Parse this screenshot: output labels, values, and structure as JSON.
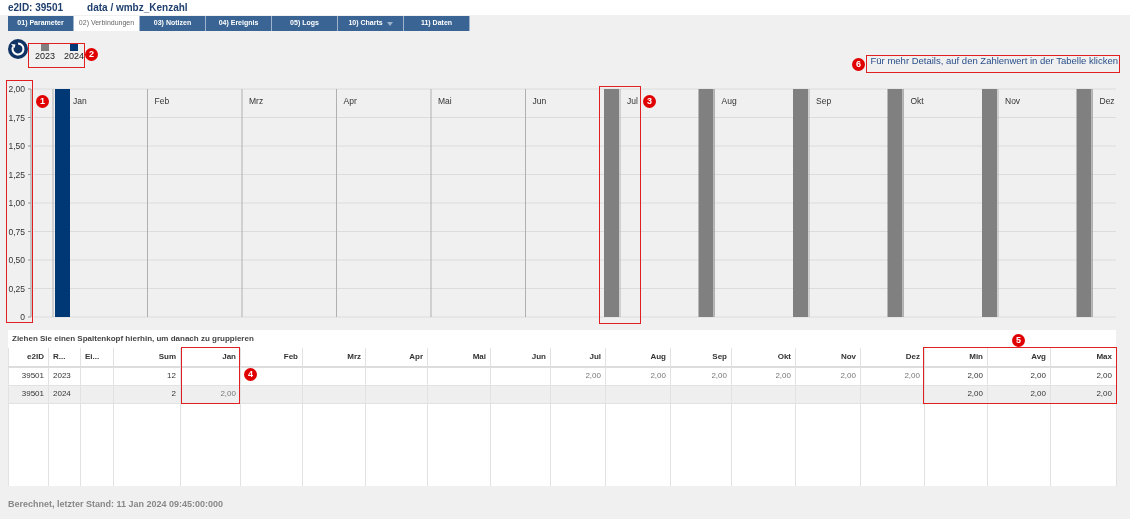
{
  "header": {
    "id_label": "e2ID: 39501",
    "path": "data / wmbz_Kenzahl"
  },
  "tabs": [
    {
      "label": "01) Parameter",
      "selected": false,
      "dropdown": false
    },
    {
      "label": "02) Verbindungen",
      "selected": true,
      "dropdown": false
    },
    {
      "label": "03) Notizen",
      "selected": false,
      "dropdown": false
    },
    {
      "label": "04) Ereignis",
      "selected": false,
      "dropdown": false
    },
    {
      "label": "05) Logs",
      "selected": false,
      "dropdown": false
    },
    {
      "label": "10) Charts",
      "selected": false,
      "dropdown": true
    },
    {
      "label": "11) Daten",
      "selected": false,
      "dropdown": false
    }
  ],
  "details_hint": "Für mehr Details, auf den Zahlenwert in der Tabelle  klicken",
  "chart_data": {
    "type": "bar",
    "categories": [
      "Jan",
      "Feb",
      "Mrz",
      "Apr",
      "Mai",
      "Jun",
      "Jul",
      "Aug",
      "Sep",
      "Okt",
      "Nov",
      "Dez"
    ],
    "series": [
      {
        "name": "2023",
        "color": "#808080",
        "values": [
          null,
          null,
          null,
          null,
          null,
          null,
          2,
          2,
          2,
          2,
          2,
          2
        ]
      },
      {
        "name": "2024",
        "color": "#003876",
        "values": [
          2,
          null,
          null,
          null,
          null,
          null,
          null,
          null,
          null,
          null,
          null,
          null
        ]
      }
    ],
    "ylim": [
      0,
      2
    ],
    "grid": true,
    "yticks": [
      0,
      {
        "value": 0.25,
        "label": "0,25"
      },
      {
        "value": 0.5,
        "label": "0,50"
      },
      {
        "value": 0.75,
        "label": "0,75"
      },
      {
        "value": 1,
        "label": "1,00"
      },
      {
        "value": 1.25,
        "label": "1,25"
      },
      {
        "value": 1.5,
        "label": "1,50"
      },
      {
        "value": 1.75,
        "label": "1,75"
      },
      {
        "value": 2,
        "label": "2,00"
      }
    ]
  },
  "grid": {
    "group_hint": "Ziehen Sie einen Spaltenkopf hierhin, um danach zu gruppieren",
    "columns": [
      "e2ID",
      "R...",
      "Ei...",
      "Sum",
      "Jan",
      "Feb",
      "Mrz",
      "Apr",
      "Mai",
      "Jun",
      "Jul",
      "Aug",
      "Sep",
      "Okt",
      "Nov",
      "Dez",
      "Min",
      "Avg",
      "Max"
    ],
    "rows": [
      {
        "cells": [
          "39501",
          "2023",
          "",
          "12",
          "",
          "",
          "",
          "",
          "",
          "",
          "2,00",
          "2,00",
          "2,00",
          "2,00",
          "2,00",
          "2,00",
          "2,00",
          "2,00",
          "2,00"
        ]
      },
      {
        "cells": [
          "39501",
          "2024",
          "",
          "2",
          "2,00",
          "",
          "",
          "",
          "",
          "",
          "",
          "",
          "",
          "",
          "",
          "",
          "2,00",
          "2,00",
          "2,00"
        ]
      }
    ]
  },
  "status": "Berechnet, letzter Stand: 11 Jan 2024 09:45:00:000",
  "callouts": [
    {
      "number": "1"
    },
    {
      "number": "2"
    },
    {
      "number": "3"
    },
    {
      "number": "4"
    },
    {
      "number": "5"
    },
    {
      "number": "6"
    }
  ]
}
